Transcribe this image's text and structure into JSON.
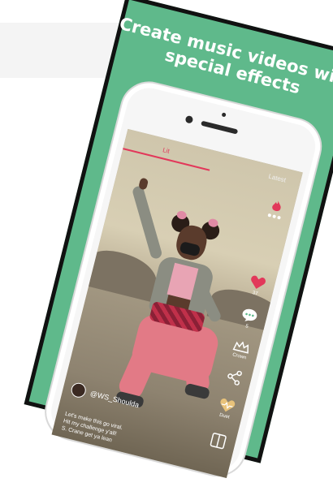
{
  "promo": {
    "headline_line1": "Create music videos with",
    "headline_line2": "special effects",
    "accent_color": "#5fb98b"
  },
  "app": {
    "tabs": [
      {
        "label": "Lit",
        "active": true
      },
      {
        "label": "Latest",
        "active": false
      }
    ],
    "rail": {
      "like_count": "37",
      "comment_count": "5",
      "crown_label": "Crown",
      "share_icon": "share-icon",
      "duet_label": "Duet"
    },
    "post": {
      "username": "@WS_Shoulda",
      "caption_lines": [
        "Let's make this go viral.",
        "Hit my challenge y'all!",
        "S. Crane get ya lean"
      ]
    }
  }
}
